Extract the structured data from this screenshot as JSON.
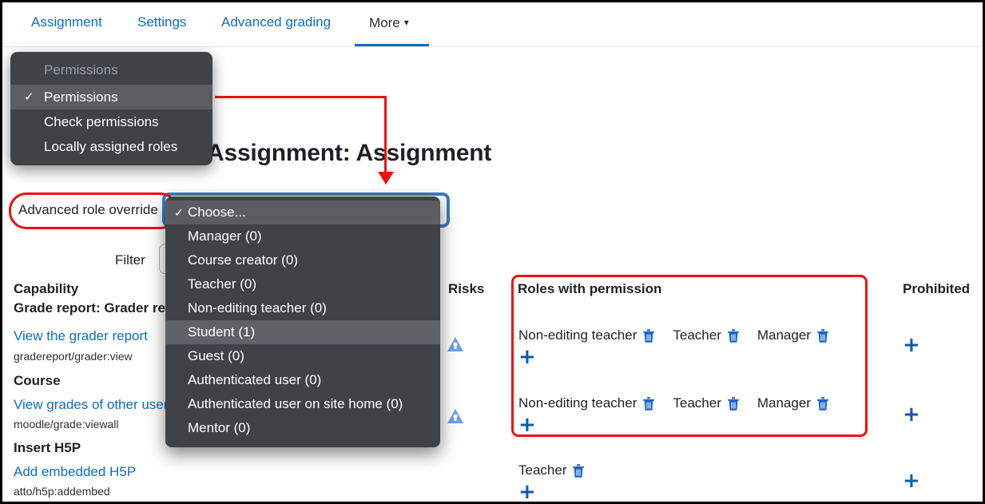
{
  "nav": {
    "tabs": [
      {
        "label": "Assignment",
        "active": false
      },
      {
        "label": "Settings",
        "active": false
      },
      {
        "label": "Advanced grading",
        "active": false
      },
      {
        "label": "More",
        "active": true,
        "caret": "chevron-down-icon"
      }
    ]
  },
  "permissions_menu": {
    "group_label": "Permissions",
    "items": [
      {
        "label": "Permissions",
        "selected": true,
        "check": "✓"
      },
      {
        "label": "Check permissions",
        "selected": false,
        "check": ""
      },
      {
        "label": "Locally assigned roles",
        "selected": false,
        "check": ""
      }
    ]
  },
  "page": {
    "title": "Assignment: Assignment"
  },
  "form": {
    "role_override_label": "Advanced role override",
    "filter_label": "Filter",
    "filter_value": "",
    "filter_placeholder": ""
  },
  "role_select": {
    "items": [
      {
        "label": "Choose...",
        "selected": true,
        "check": "✓"
      },
      {
        "label": "Manager (0)",
        "selected": false,
        "check": ""
      },
      {
        "label": "Course creator (0)",
        "selected": false,
        "check": ""
      },
      {
        "label": "Teacher (0)",
        "selected": false,
        "check": ""
      },
      {
        "label": "Non-editing teacher (0)",
        "selected": false,
        "check": ""
      },
      {
        "label": "Student (1)",
        "selected": true,
        "check": ""
      },
      {
        "label": "Guest (0)",
        "selected": false,
        "check": ""
      },
      {
        "label": "Authenticated user (0)",
        "selected": false,
        "check": ""
      },
      {
        "label": "Authenticated user on site home (0)",
        "selected": false,
        "check": ""
      },
      {
        "label": "Mentor (0)",
        "selected": false,
        "check": ""
      }
    ]
  },
  "table": {
    "headers": {
      "capability": "Capability",
      "risks": "Risks",
      "roles_with_permission": "Roles with permission",
      "prohibited": "Prohibited"
    },
    "rows": [
      {
        "group": "Grade report: Grader report",
        "capability_name": "View the grader report",
        "capability_code": "gradereport/grader:view",
        "risk_icon": "risk-personal-icon",
        "roles": [
          "Non-editing teacher",
          "Teacher",
          "Manager"
        ],
        "add_label": "+",
        "prohibited_add_label": "+"
      },
      {
        "group": "Course",
        "capability_name": "View grades of other users",
        "capability_code": "moodle/grade:viewall",
        "risk_icon": "risk-personal-icon",
        "roles": [
          "Non-editing teacher",
          "Teacher",
          "Manager"
        ],
        "add_label": "+",
        "prohibited_add_label": "+"
      },
      {
        "group": "Insert H5P",
        "capability_name": "Add embedded H5P",
        "capability_code": "atto/h5p:addembed",
        "risk_icon": "",
        "roles": [
          "Teacher"
        ],
        "add_label": "+",
        "prohibited_add_label": "+"
      }
    ]
  },
  "colors": {
    "link": "#0f6cbf",
    "annotation": "#f40c0c",
    "focus_ring": "#3b7ec4",
    "menu_bg": "#3f4246",
    "menu_selected": "#5f6368",
    "icon_blue": "#0b5ab5",
    "risk_blue": "#6f9de8"
  }
}
